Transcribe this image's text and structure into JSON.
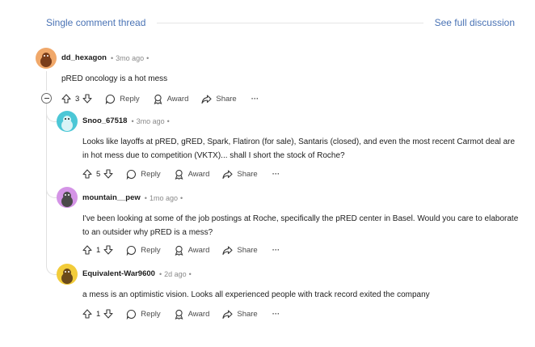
{
  "header": {
    "single_thread_label": "Single comment thread",
    "full_discussion_label": "See full discussion"
  },
  "actions": {
    "reply": "Reply",
    "award": "Award",
    "share": "Share",
    "more": "···"
  },
  "comments": [
    {
      "username": "dd_hexagon",
      "time": "3mo ago",
      "body": "pRED oncology is a hot mess",
      "score": "3",
      "avatar_color": "#f0a86a"
    },
    {
      "username": "Snoo_67518",
      "time": "3mo ago",
      "body": "Looks like layoffs at pRED, gRED, Spark, Flatiron (for sale), Santaris (closed), and even the most recent Carmot deal are in hot mess due to competition (VKTX)... shall I short the stock of Roche?",
      "score": "5",
      "avatar_color": "#4cc7d6"
    },
    {
      "username": "mountain__pew",
      "time": "1mo ago",
      "body": "I've been looking at some of the job postings at Roche, specifically the pRED center in Basel. Would you care to elaborate to an outsider why pRED is a mess?",
      "score": "1",
      "avatar_color": "#d494e6"
    },
    {
      "username": "Equivalent-War9600",
      "time": "2d ago",
      "body": "a mess is an optimistic vision. Looks all experienced people with track record exited the company",
      "score": "1",
      "avatar_color": "#f2cc3a"
    }
  ],
  "icons": {
    "upvote": "arrow-up-icon",
    "downvote": "arrow-down-icon",
    "reply": "speech-bubble-icon",
    "award": "award-ribbon-icon",
    "share": "share-arrow-icon",
    "collapse": "minus-circle-icon"
  }
}
